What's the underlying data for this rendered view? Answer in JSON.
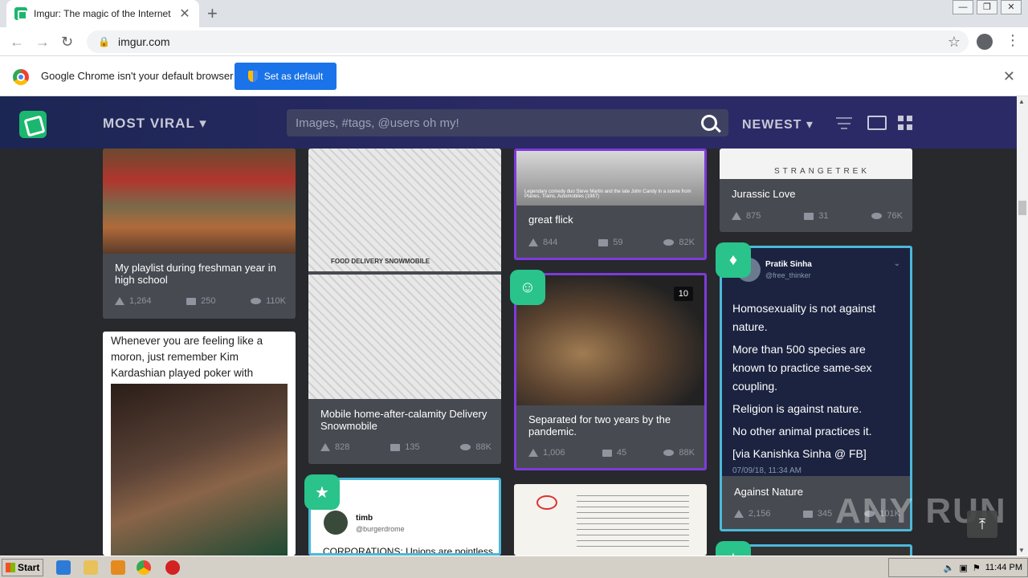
{
  "browser": {
    "tab_title": "Imgur: The magic of the Internet",
    "url": "imgur.com",
    "infobar_text": "Google Chrome isn't your default browser",
    "default_button": "Set as default"
  },
  "imgur": {
    "section_label": "MOST VIRAL",
    "search_placeholder": "Images, #tags, @users oh my!",
    "sort_label": "NEWEST"
  },
  "posts": [
    {
      "title": "My playlist during freshman year in high school",
      "ups": "1,264",
      "comments": "250",
      "views": "110K"
    },
    {
      "title": "Mobile home-after-calamity Delivery Snowmobile",
      "ups": "828",
      "comments": "135",
      "views": "88K"
    },
    {
      "title": "great flick",
      "ups": "844",
      "comments": "59",
      "views": "82K"
    },
    {
      "title": "Separated for two years by the pandemic.",
      "ups": "1,006",
      "comments": "45",
      "views": "88K",
      "image_count": "10"
    },
    {
      "title": "Jurassic Love",
      "ups": "875",
      "comments": "31",
      "views": "76K"
    },
    {
      "title": "Against Nature",
      "ups": "2,156",
      "comments": "345",
      "views": "101K"
    }
  ],
  "kim_post": {
    "caption": "Whenever you are feeling like a moron, just remember Kim Kardashian played poker with mirrored glasses."
  },
  "tweet_post": {
    "name": "timb",
    "handle": "@burgerdrome",
    "text": "CORPORATIONS: Unions are pointless"
  },
  "nature_tweet": {
    "name": "Pratik Sinha",
    "handle": "@free_thinker",
    "lines": [
      "Homosexuality is not against nature.",
      "More than 500 species are known to practice same-sex coupling.",
      "Religion is against nature.",
      "No other animal practices it.",
      "[via Kanishka Sinha @ FB]"
    ],
    "timestamp": "07/09/18, 11:34 AM"
  },
  "image_labels": {
    "strangetrek": "STRANGETREK",
    "food_delivery": "FOOD DELIVERY SNOWMOBILE",
    "movie_caption": "Legendary comedy duo Steve Martin and the late John Candy in a scene from Planes, Trains, Automobiles (1987)"
  },
  "taskbar": {
    "start_label": "Start",
    "clock": "11:44 PM"
  },
  "watermark": "ANY RUN"
}
